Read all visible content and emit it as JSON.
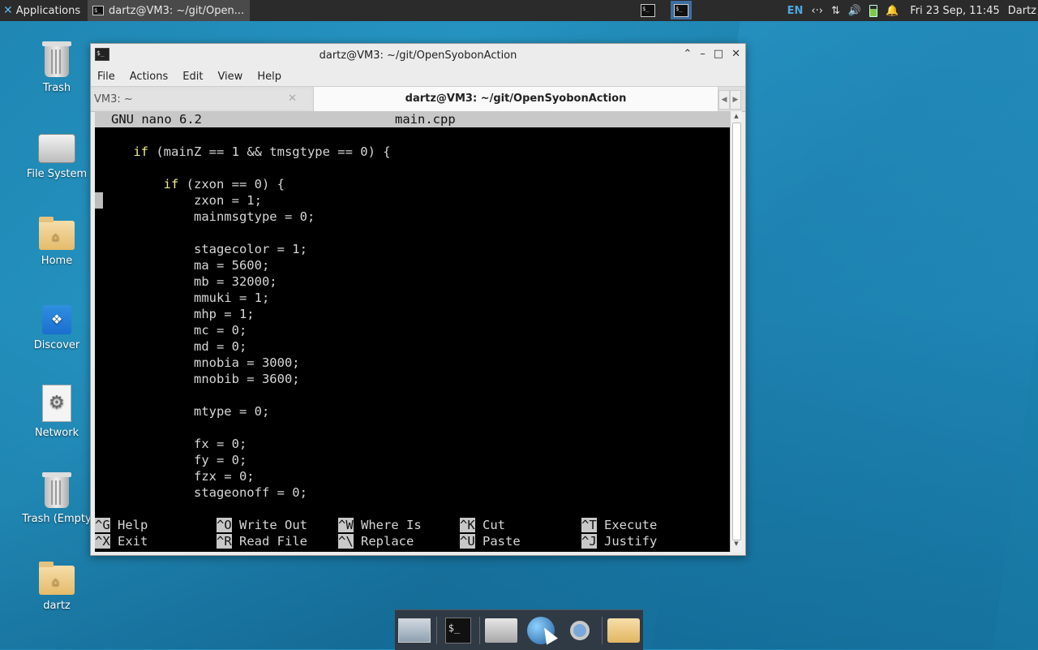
{
  "panel": {
    "apps_label": "Applications",
    "task_label": "dartz@VM3: ~/git/Open...",
    "lang": "EN",
    "datetime": "Fri 23 Sep, 11:45",
    "user": "Dartz"
  },
  "desktop": {
    "icons": [
      {
        "label": "Trash"
      },
      {
        "label": "File System"
      },
      {
        "label": "Home"
      },
      {
        "label": "Discover"
      },
      {
        "label": "Network"
      },
      {
        "label": "Trash (Empty"
      },
      {
        "label": "dartz"
      }
    ]
  },
  "window": {
    "title": "dartz@VM3: ~/git/OpenSyobonAction",
    "menu": [
      "File",
      "Actions",
      "Edit",
      "View",
      "Help"
    ],
    "tabs": [
      {
        "label": "VM3: ~"
      },
      {
        "label": "dartz@VM3: ~/git/OpenSyobonAction"
      }
    ]
  },
  "nano": {
    "version": "GNU nano 6.2",
    "filename": "main.cpp",
    "lines": [
      "",
      "    if (mainZ == 1 && tmsgtype == 0) {",
      "",
      "        if (zxon == 0) {",
      "            zxon = 1;",
      "            mainmsgtype = 0;",
      "",
      "            stagecolor = 1;",
      "            ma = 5600;",
      "            mb = 32000;",
      "            mmuki = 1;",
      "            mhp = 1;",
      "            mc = 0;",
      "            md = 0;",
      "            mnobia = 3000;",
      "            mnobib = 3600;",
      "",
      "            mtype = 0;",
      "",
      "            fx = 0;",
      "            fy = 0;",
      "            fzx = 0;",
      "            stageonoff = 0;"
    ],
    "shortcuts": [
      {
        "key": "^G",
        "label": "Help"
      },
      {
        "key": "^O",
        "label": "Write Out"
      },
      {
        "key": "^W",
        "label": "Where Is"
      },
      {
        "key": "^K",
        "label": "Cut"
      },
      {
        "key": "^T",
        "label": "Execute"
      },
      {
        "key": "^X",
        "label": "Exit"
      },
      {
        "key": "^R",
        "label": "Read File"
      },
      {
        "key": "^\\",
        "label": "Replace"
      },
      {
        "key": "^U",
        "label": "Paste"
      },
      {
        "key": "^J",
        "label": "Justify"
      }
    ]
  },
  "colors": {
    "desktop_bg": "#1f86b3",
    "panel_bg": "#2b2b2b",
    "keyword": "#f2ef8a",
    "terminal_bg": "#000000"
  }
}
